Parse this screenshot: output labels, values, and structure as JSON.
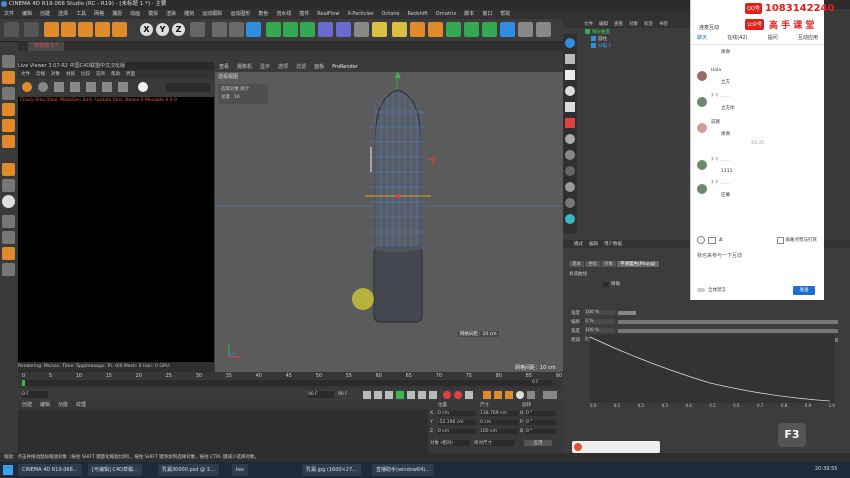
{
  "window": {
    "title": "CINEMA 4D R19.068 Studio (RC - R19) - [未标题 1 *] - 主要"
  },
  "menubar": [
    "文件",
    "编辑",
    "创建",
    "选择",
    "工具",
    "网格",
    "捕捉",
    "动画",
    "模拟",
    "渲染",
    "雕刻",
    "运动跟踪",
    "运动图形",
    "角色",
    "流水线",
    "插件",
    "RealFlow",
    "X-Particles",
    "Octane",
    "Redshift",
    "Ornatrix",
    "脚本",
    "窗口",
    "帮助"
  ],
  "tabs": {
    "doc": "未标题 1 *"
  },
  "live_viewer": {
    "title": "Live Viewer 3.07-R2 中国C4D联盟中文汉化版",
    "menu": [
      "文件",
      "云端",
      "对象",
      "材质",
      "比较",
      "选项",
      "帮助",
      "界面"
    ],
    "status": "Check 0ms./0ms. MeshGen 0ms. Update 0ms. Nodes 0 Movable 0  0 0",
    "footer": "Rendering:   Ms/sec:   Time:   Spp/maxspp:   Tri: 0/0   Mesh: 0   Hair: 0   GPU:"
  },
  "viewport": {
    "menu": [
      "查看",
      "摄像机",
      "显示",
      "选项",
      "过滤",
      "面板",
      "ProRender"
    ],
    "label": "透视视图",
    "snap_box": {
      "title": "选取对象 统计",
      "row_label": "总量",
      "row_value": "16"
    },
    "grid_scale": "网格间距：10 cm",
    "distance": "网格间距：10 cm"
  },
  "timeline": {
    "ticks": [
      "0",
      "5",
      "10",
      "15",
      "20",
      "25",
      "30",
      "35",
      "40",
      "45",
      "50",
      "55",
      "60",
      "65",
      "70",
      "75",
      "80",
      "85",
      "90"
    ],
    "current": "0 F",
    "start": "0 F",
    "end": "90 F",
    "end2": "90 F"
  },
  "material": {
    "menu": [
      "创建",
      "编辑",
      "功能",
      "纹理"
    ]
  },
  "coordinates": {
    "headers": [
      "位置",
      "尺寸",
      "旋转"
    ],
    "rows": [
      {
        "axis": "X",
        "pos": "0 cm",
        "size": "118.769 cm",
        "rot_axis": "H",
        "rot": "0 °"
      },
      {
        "axis": "Y",
        "pos": "-52.196 cm",
        "size": "0 cm",
        "rot_axis": "P",
        "rot": "0 °"
      },
      {
        "axis": "Z",
        "pos": "0 cm",
        "size": "100 cm",
        "rot_axis": "B",
        "rot": "0 °"
      }
    ],
    "mode": "对象 (相对)",
    "mode2": "绝对尺寸",
    "apply": "应用"
  },
  "statusbar": "缩放：点击并拖动鼠标缩放对象（按住 SHIFT 键量化缩放比例）。按住 SHIFT 键添加到选择对象，按住 CTRL 键减少选择对象。",
  "objects": {
    "menu": [
      "文件",
      "编辑",
      "查看",
      "对象",
      "标签",
      "书签"
    ],
    "items": [
      {
        "name": "细分曲面"
      },
      {
        "name": "圆柱"
      },
      {
        "name": "扫描.1"
      }
    ]
  },
  "attributes": {
    "menu": [
      "模式",
      "编辑",
      "用户数据"
    ],
    "tabs": [
      "基本",
      "坐标",
      "对象",
      "平滑着色(Phong)"
    ],
    "section": "衰减曲线",
    "selected_tab": "衰减曲线",
    "checkbox": "精确",
    "fields": [
      {
        "label": "强度",
        "value": "100 %"
      },
      {
        "label": "偏移",
        "value": "0 %"
      },
      {
        "label": "宽度",
        "value": "100 %"
      },
      {
        "label": "衰减",
        "value": "0 %"
      }
    ],
    "graph_ticks": [
      "0.0",
      "0.1",
      "0.2",
      "0.3",
      "0.4",
      "0.5",
      "0.6",
      "0.7",
      "0.8",
      "0.9",
      "1.0"
    ]
  },
  "chat": {
    "header": "连麦互动",
    "tabs": [
      "聊天",
      "在线(42)",
      "提问",
      "互动应用"
    ],
    "messages": [
      {
        "name": "",
        "text": "谢谢"
      },
      {
        "name": "Hola",
        "text": "立方"
      },
      {
        "name": "？？. . . .",
        "text": "立方体"
      },
      {
        "name": "前路",
        "text": "谢谢"
      },
      {
        "name": "",
        "text": "20:35"
      },
      {
        "name": "？？. . . .",
        "text": "1111"
      },
      {
        "name": "？？. . . .",
        "text": "圧瘪"
      }
    ],
    "hint": "屏蔽点赞与打赏",
    "input_placeholder": "我也来参与一下互动",
    "mute": "全体禁言",
    "send": "发送"
  },
  "qq": {
    "label": "QQ号",
    "number": "1083142240",
    "label2": "公众号",
    "slogan": "高 手 课 堂"
  },
  "f3_badge": "F3",
  "taskbar": {
    "items": [
      "CINEMA 4D R19.068...",
      "[可编辑] C4D草稿...",
      "乳霜30000.psd @ 3...",
      "tex",
      "乳霜.jpg (1600×27...",
      "直播助手(window64)..."
    ],
    "time": "20:39:55"
  },
  "colors": {
    "accent": "#e05050",
    "viewport_bg": "#5b5b5b",
    "blue_tab": "#1f6fd1",
    "qq_red": "#e0201a"
  }
}
